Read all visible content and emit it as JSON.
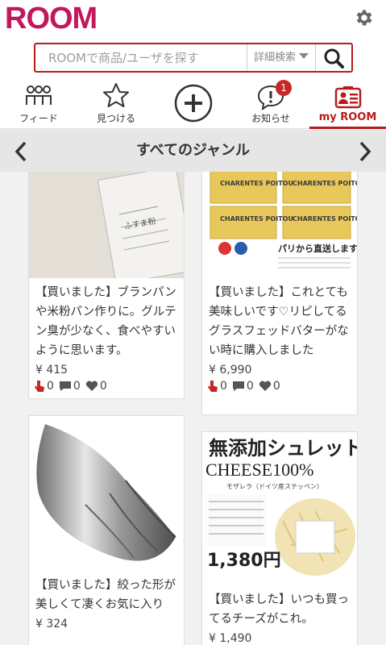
{
  "app": {
    "logo": "ROOM"
  },
  "search": {
    "placeholder": "ROOMで商品/ユーザを探す",
    "advanced_label": "詳細検索"
  },
  "nav": [
    {
      "label": "フィード",
      "icon": "people-icon"
    },
    {
      "label": "見つける",
      "icon": "star-icon"
    },
    {
      "label": "",
      "icon": "plus-icon"
    },
    {
      "label": "お知らせ",
      "icon": "notification-icon",
      "badge": "1"
    },
    {
      "label": "my ROOM",
      "icon": "myroom-icon",
      "active": true
    }
  ],
  "genre": {
    "title": "すべてのジャンル"
  },
  "colors": {
    "brand": "#c2185b",
    "accent": "#b71c1c",
    "like": "#c62828"
  },
  "items": [
    {
      "text": "【買いました】ブランパンや米粉パン作りに。グルテン臭が少なく、食べやすいように思います。",
      "price": "¥ 415",
      "likes": "0",
      "comments": "0",
      "hearts": "0",
      "image": "flour-bag-image",
      "image_label": "ふすま粉"
    },
    {
      "text": "【買いました】これとても美味しいです♡リピしてるグラスフェッドバターがない時に購入しました",
      "price": "¥ 6,990",
      "likes": "0",
      "comments": "0",
      "hearts": "0",
      "image": "butter-image",
      "image_labels": [
        "CHARENTES POITOU",
        "CHARENTES POITOU",
        "CHARENTES POITOU",
        "CHARENTES POITOU"
      ],
      "image_caption": "パリから直送します！"
    },
    {
      "text": "【買いました】絞った形が美しくて凄くお気に入り",
      "price": "¥ 324",
      "image": "piping-tip-image"
    },
    {
      "text": "【買いました】いつも買ってるチーズがこれ。",
      "price": "¥ 1,490",
      "image": "cheese-image",
      "image_title": "無添加シュレット",
      "image_subtitle": "CHEESE100%",
      "image_note": "モザレラ（ドイツ産ステッペン）",
      "image_price": "1,380円"
    }
  ]
}
